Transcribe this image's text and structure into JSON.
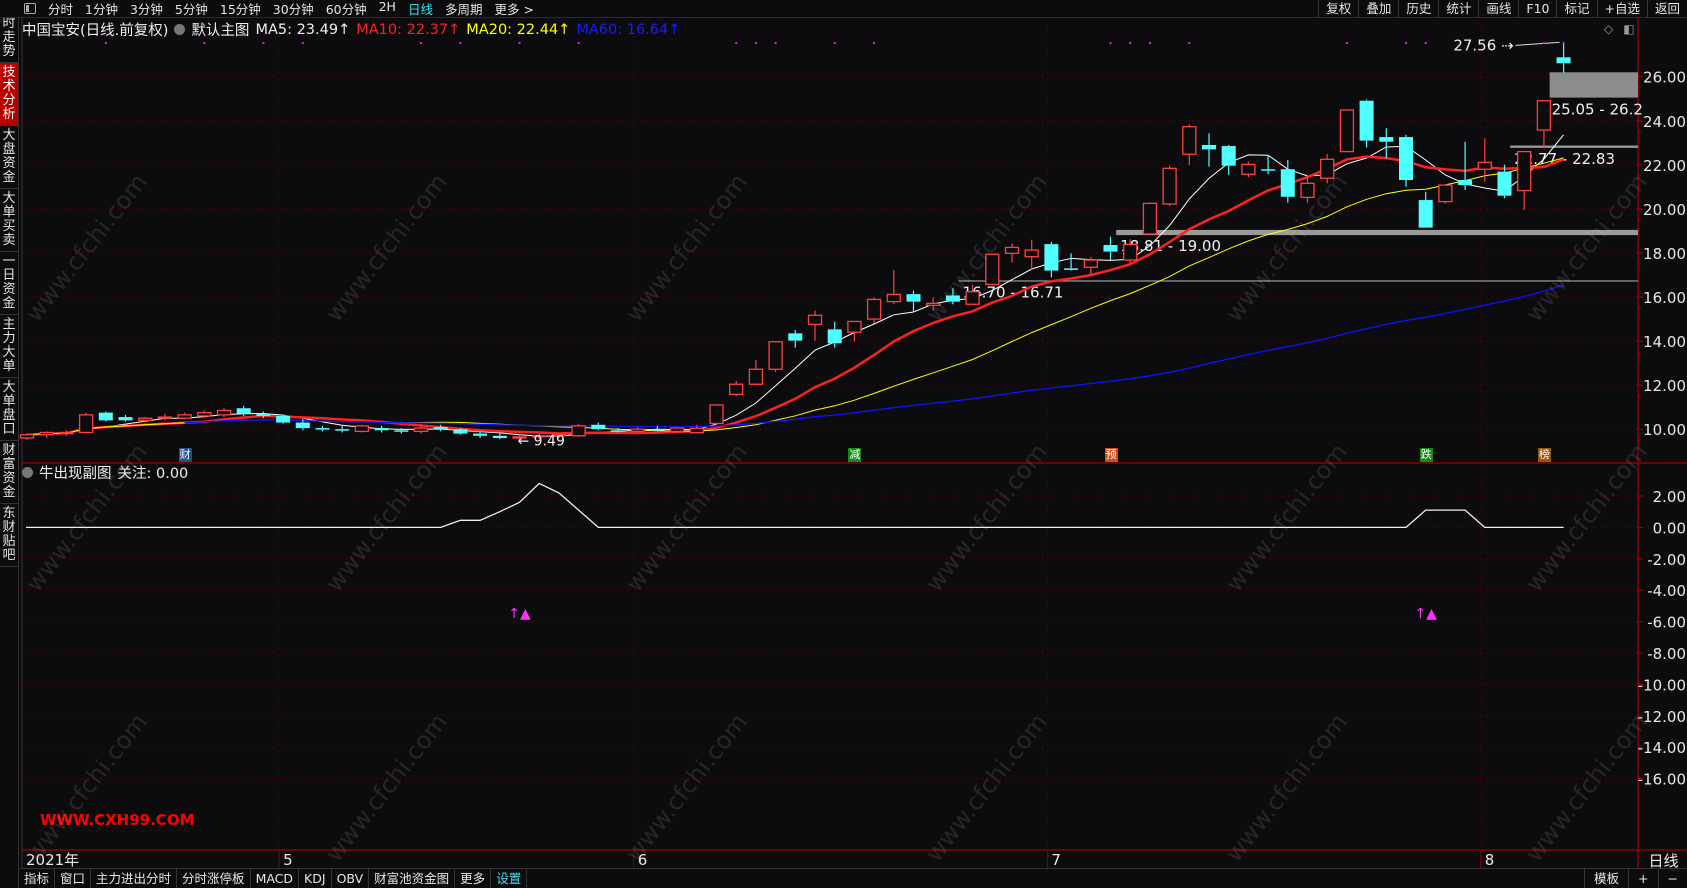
{
  "toolbar": {
    "periods": [
      "分时",
      "1分钟",
      "3分钟",
      "5分钟",
      "15分钟",
      "30分钟",
      "60分钟",
      "2H",
      "日线",
      "多周期",
      "更多 >"
    ],
    "active_period": "日线",
    "right": [
      "复权",
      "叠加",
      "历史",
      "统计",
      "画线",
      "F10",
      "标记",
      "+自选",
      "返回"
    ]
  },
  "sidebar": [
    "分时走势",
    "技术分析",
    "大盘资金",
    "大单买卖",
    "一日资金",
    "主力大单",
    "大单盘口",
    "财富资金",
    "东财贴吧"
  ],
  "sidebar_active": "技术分析",
  "header": {
    "stock": "中国宝安(日线.前复权)",
    "template": "默认主图",
    "ma5": "MA5: 23.49↑",
    "ma10": "MA10: 22.37↑",
    "ma20": "MA20: 22.44↑",
    "ma60": "MA60: 16.64↑"
  },
  "colors": {
    "ma5": "#ffffff",
    "ma10": "#ff2020",
    "ma20": "#ffff00",
    "ma60": "#1010ff",
    "up": "#ff4040",
    "down": "#50ffff",
    "grid": "#6a0000"
  },
  "sub": {
    "title": "牛出现副图",
    "focus": "关注: 0.00"
  },
  "price_labels": {
    "low": "9.49",
    "high": "27.56",
    "zone1": "16.70 - 16.71",
    "zone2": "18.81 - 19.00",
    "zone3": "22.77 - 22.83",
    "zone4": "25.05 - 26.2"
  },
  "chart_data": {
    "type": "candlestick",
    "ohlc": [
      [
        9.6,
        9.8,
        9.5,
        9.75
      ],
      [
        9.75,
        9.9,
        9.6,
        9.85
      ],
      [
        9.8,
        9.95,
        9.7,
        9.85
      ],
      [
        9.85,
        10.75,
        9.8,
        10.65
      ],
      [
        10.75,
        10.8,
        10.35,
        10.4
      ],
      [
        10.55,
        10.65,
        10.35,
        10.4
      ],
      [
        10.4,
        10.55,
        10.3,
        10.5
      ],
      [
        10.5,
        10.7,
        10.4,
        10.55
      ],
      [
        10.5,
        10.75,
        10.45,
        10.65
      ],
      [
        10.6,
        10.85,
        10.5,
        10.75
      ],
      [
        10.65,
        10.95,
        10.55,
        10.85
      ],
      [
        10.95,
        11.05,
        10.6,
        10.7
      ],
      [
        10.7,
        10.8,
        10.5,
        10.6
      ],
      [
        10.6,
        10.65,
        10.25,
        10.3
      ],
      [
        10.3,
        10.45,
        9.95,
        10.05
      ],
      [
        10.05,
        10.15,
        9.9,
        10.0
      ],
      [
        10.0,
        10.15,
        9.85,
        9.95
      ],
      [
        9.9,
        10.2,
        9.85,
        10.15
      ],
      [
        10.05,
        10.15,
        9.85,
        9.95
      ],
      [
        9.95,
        10.05,
        9.8,
        9.9
      ],
      [
        9.9,
        10.2,
        9.8,
        10.05
      ],
      [
        10.1,
        10.2,
        9.9,
        10.0
      ],
      [
        10.0,
        10.05,
        9.75,
        9.8
      ],
      [
        9.8,
        9.9,
        9.6,
        9.7
      ],
      [
        9.7,
        9.8,
        9.55,
        9.6
      ],
      [
        9.6,
        9.75,
        9.49,
        9.65
      ],
      [
        9.65,
        9.8,
        9.55,
        9.7
      ],
      [
        9.7,
        9.8,
        9.6,
        9.75
      ],
      [
        9.7,
        10.25,
        9.65,
        10.15
      ],
      [
        10.2,
        10.3,
        9.95,
        10.0
      ],
      [
        9.95,
        10.05,
        9.85,
        9.9
      ],
      [
        9.9,
        10.1,
        9.85,
        10.0
      ],
      [
        10.0,
        10.15,
        9.9,
        9.95
      ],
      [
        9.9,
        10.1,
        9.85,
        10.05
      ],
      [
        9.84,
        10.2,
        9.8,
        10.04
      ],
      [
        10.26,
        11.1,
        10.2,
        11.1
      ],
      [
        11.58,
        12.19,
        11.5,
        12.04
      ],
      [
        12.04,
        13.14,
        12.0,
        12.72
      ],
      [
        12.72,
        13.97,
        12.6,
        13.97
      ],
      [
        14.35,
        14.5,
        13.7,
        14.02
      ],
      [
        14.76,
        15.38,
        14.02,
        15.17
      ],
      [
        14.53,
        14.88,
        13.7,
        13.9
      ],
      [
        14.4,
        14.89,
        13.97,
        14.89
      ],
      [
        15.0,
        15.98,
        14.8,
        15.89
      ],
      [
        15.79,
        17.23,
        15.67,
        16.12
      ],
      [
        16.13,
        16.29,
        15.33,
        15.79
      ],
      [
        15.62,
        15.98,
        15.38,
        15.71
      ],
      [
        16.07,
        16.4,
        15.67,
        15.79
      ],
      [
        15.67,
        16.54,
        15.67,
        16.24
      ],
      [
        16.57,
        17.94,
        16.57,
        17.94
      ],
      [
        17.98,
        18.43,
        17.56,
        18.25
      ],
      [
        17.83,
        18.6,
        17.25,
        18.13
      ],
      [
        18.4,
        18.5,
        16.89,
        17.2
      ],
      [
        17.3,
        17.98,
        17.2,
        17.23
      ],
      [
        17.35,
        17.83,
        17.0,
        17.68
      ],
      [
        18.36,
        18.74,
        17.68,
        18.06
      ],
      [
        17.68,
        18.62,
        17.53,
        18.39
      ],
      [
        18.86,
        20.3,
        18.8,
        20.25
      ],
      [
        20.22,
        21.95,
        20.13,
        21.84
      ],
      [
        22.48,
        23.84,
        21.99,
        23.73
      ],
      [
        22.9,
        23.43,
        21.92,
        22.7
      ],
      [
        22.85,
        22.9,
        21.54,
        21.96
      ],
      [
        21.57,
        22.14,
        21.43,
        22.02
      ],
      [
        21.8,
        22.45,
        21.58,
        21.78
      ],
      [
        21.8,
        22.22,
        20.28,
        20.55
      ],
      [
        20.52,
        21.5,
        20.28,
        21.16
      ],
      [
        21.39,
        22.49,
        21.16,
        22.25
      ],
      [
        22.6,
        24.49,
        22.6,
        24.49
      ],
      [
        24.91,
        24.96,
        22.79,
        23.1
      ],
      [
        23.26,
        23.66,
        22.29,
        23.05
      ],
      [
        23.26,
        23.36,
        21.01,
        21.31
      ],
      [
        20.4,
        20.78,
        19.15,
        19.15
      ],
      [
        20.33,
        21.08,
        20.25,
        21.08
      ],
      [
        21.31,
        23.05,
        20.86,
        21.08
      ],
      [
        21.8,
        23.2,
        21.24,
        22.11
      ],
      [
        21.69,
        22.0,
        20.48,
        20.6
      ],
      [
        20.83,
        22.6,
        19.95,
        22.6
      ],
      [
        23.58,
        24.91,
        22.75,
        24.91
      ],
      [
        26.88,
        27.56,
        26.18,
        26.61
      ]
    ],
    "ma_periods": [
      5,
      10,
      20,
      60
    ],
    "price_ylim": [
      9,
      28
    ],
    "price_ticks": [
      "26.00",
      "24.00",
      "22.00",
      "20.00",
      "18.00",
      "16.00",
      "14.00",
      "12.00",
      "10.00"
    ],
    "sub_ticks": [
      "2.00",
      "0.00",
      "-2.00",
      "-4.00",
      "-6.00",
      "-8.00",
      "-10.00",
      "-12.00",
      "-14.00",
      "-16.00"
    ],
    "sub_values": {
      "22": 0.45,
      "23": 0.45,
      "24": 1.0,
      "25": 1.6,
      "26": 2.8,
      "27": 2.2,
      "28": 1.1,
      "71": 1.1,
      "72": 1.1,
      "73": 1.1
    },
    "sub_signals": [
      25,
      71
    ],
    "signal_glyph": "↑▲",
    "event_dots": [
      4,
      9,
      12,
      14,
      20,
      22,
      25,
      28,
      36,
      37,
      38,
      41,
      43,
      55,
      56,
      57,
      59,
      67,
      70,
      71,
      77,
      78
    ],
    "events": [
      {
        "index": 8,
        "label": "财",
        "color": "#1d4f8a"
      },
      {
        "index": 42,
        "label": "减",
        "color": "#168a16"
      },
      {
        "index": 55,
        "label": "预",
        "color": "#c8501a"
      },
      {
        "index": 71,
        "label": "跌",
        "color": "#168a16"
      },
      {
        "index": 77,
        "label": "榜",
        "color": "#9a5210"
      }
    ],
    "zones": [
      {
        "low": 16.7,
        "high": 16.71,
        "from": 48,
        "label": "zone1"
      },
      {
        "low": 18.81,
        "high": 19.0,
        "from": 56,
        "label": "zone2"
      },
      {
        "low": 22.77,
        "high": 22.83,
        "from": 76,
        "label": "zone3"
      },
      {
        "low": 25.05,
        "high": 26.2,
        "from": 78,
        "label": "zone4"
      }
    ],
    "months": [
      {
        "index": 0,
        "label": "2021年"
      },
      {
        "index": 13,
        "label": "5"
      },
      {
        "index": 31,
        "label": "6"
      },
      {
        "index": 52,
        "label": "7"
      },
      {
        "index": 74,
        "label": "8"
      }
    ]
  },
  "bottombar": {
    "items": [
      "指标",
      "窗口",
      "主力进出分时",
      "分时涨停板",
      "MACD",
      "KDJ",
      "OBV",
      "财富池资金图",
      "更多",
      "设置"
    ],
    "right": [
      "模板",
      "+",
      "−"
    ],
    "period": "日线"
  },
  "watermark": "www.cfchi.com",
  "overlay_text": "WWW.CXH99.COM"
}
